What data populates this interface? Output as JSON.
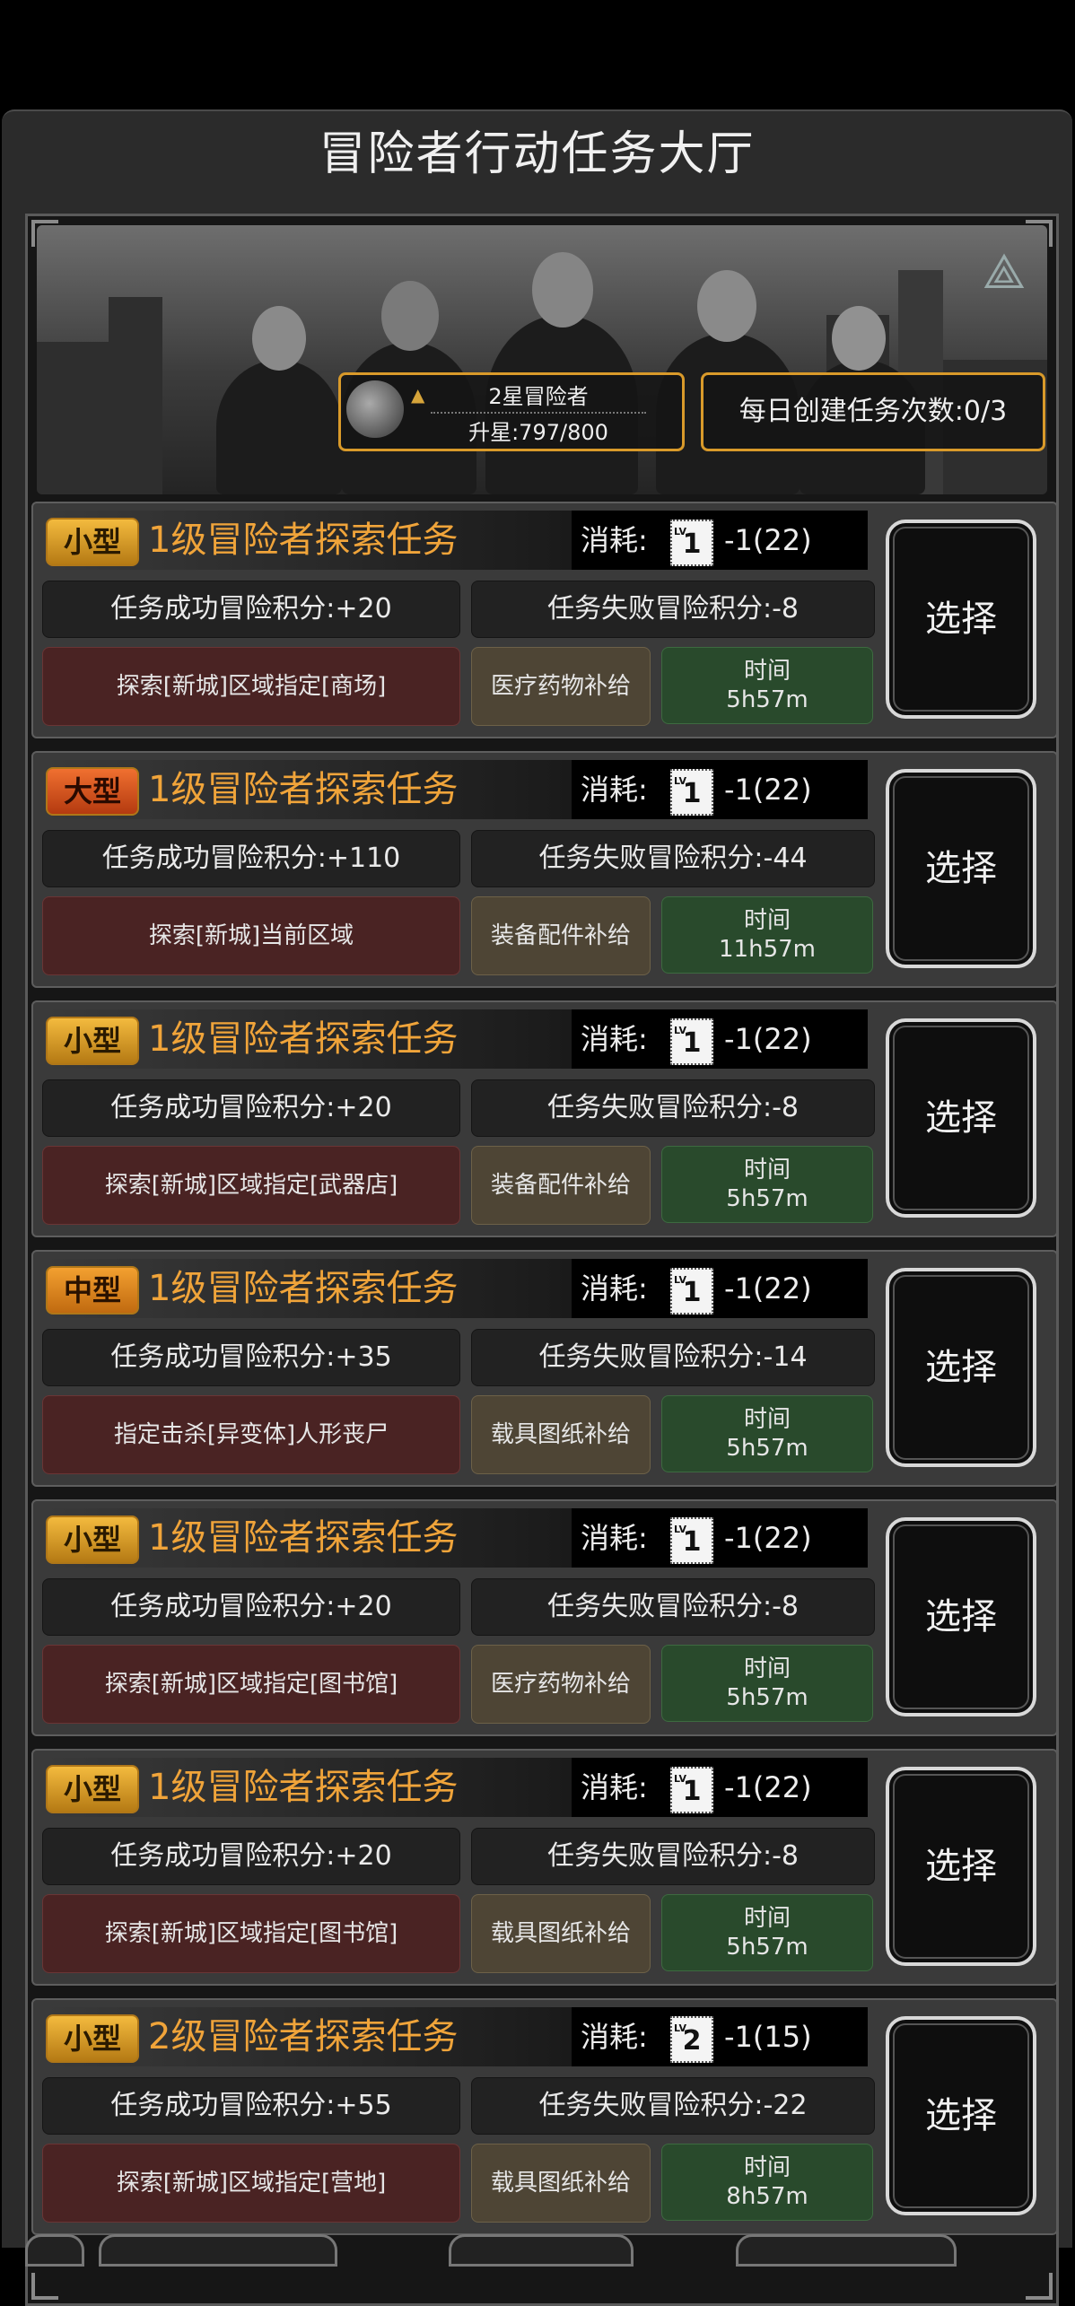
{
  "hall": {
    "title": "冒险者行动任务大厅"
  },
  "rank": {
    "name": "2星冒险者",
    "progress": "升星:797/800"
  },
  "daily": {
    "label": "每日创建任务次数:0/3"
  },
  "common": {
    "cost_label": "消耗:",
    "select_label": "选择",
    "time_label": "时间",
    "card_lv": "LV"
  },
  "tasks": [
    {
      "size": "小型",
      "size_kind": "small",
      "title": "1级冒险者探索任务",
      "card_level": "1",
      "cost": "-1(22)",
      "success": "任务成功冒险积分:+20",
      "fail": "任务失败冒险积分:-8",
      "target": "探索[新城]区域指定[商场]",
      "reward": "医疗药物补给",
      "time": "5h57m"
    },
    {
      "size": "大型",
      "size_kind": "large",
      "title": "1级冒险者探索任务",
      "card_level": "1",
      "cost": "-1(22)",
      "success": "任务成功冒险积分:+110",
      "fail": "任务失败冒险积分:-44",
      "target": "探索[新城]当前区域",
      "reward": "装备配件补给",
      "time": "11h57m"
    },
    {
      "size": "小型",
      "size_kind": "small",
      "title": "1级冒险者探索任务",
      "card_level": "1",
      "cost": "-1(22)",
      "success": "任务成功冒险积分:+20",
      "fail": "任务失败冒险积分:-8",
      "target": "探索[新城]区域指定[武器店]",
      "reward": "装备配件补给",
      "time": "5h57m"
    },
    {
      "size": "中型",
      "size_kind": "medium",
      "title": "1级冒险者探索任务",
      "card_level": "1",
      "cost": "-1(22)",
      "success": "任务成功冒险积分:+35",
      "fail": "任务失败冒险积分:-14",
      "target": "指定击杀[异变体]人形丧尸",
      "reward": "载具图纸补给",
      "time": "5h57m"
    },
    {
      "size": "小型",
      "size_kind": "small",
      "title": "1级冒险者探索任务",
      "card_level": "1",
      "cost": "-1(22)",
      "success": "任务成功冒险积分:+20",
      "fail": "任务失败冒险积分:-8",
      "target": "探索[新城]区域指定[图书馆]",
      "reward": "医疗药物补给",
      "time": "5h57m"
    },
    {
      "size": "小型",
      "size_kind": "small",
      "title": "1级冒险者探索任务",
      "card_level": "1",
      "cost": "-1(22)",
      "success": "任务成功冒险积分:+20",
      "fail": "任务失败冒险积分:-8",
      "target": "探索[新城]区域指定[图书馆]",
      "reward": "载具图纸补给",
      "time": "5h57m"
    },
    {
      "size": "小型",
      "size_kind": "small",
      "title": "2级冒险者探索任务",
      "card_level": "2",
      "cost": "-1(15)",
      "success": "任务成功冒险积分:+55",
      "fail": "任务失败冒险积分:-22",
      "target": "探索[新城]区域指定[营地]",
      "reward": "载具图纸补给",
      "time": "8h57m"
    }
  ]
}
